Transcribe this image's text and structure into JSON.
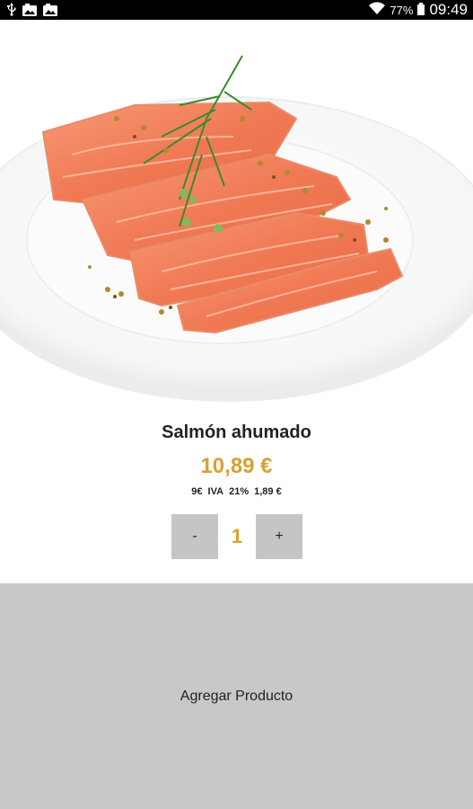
{
  "status_bar": {
    "icons_left": [
      "usb-icon",
      "photo-icon",
      "photo-icon"
    ],
    "battery": "77%",
    "time": "09:49"
  },
  "product": {
    "image_description_icon": "smoked-salmon-plate-image",
    "name": "Salmón ahumado",
    "price": "10,89 €",
    "tax": {
      "base": "9€",
      "label": "IVA",
      "rate": "21%",
      "amount": "1,89 €"
    }
  },
  "quantity": {
    "minus_label": "-",
    "value": "1",
    "plus_label": "+"
  },
  "actions": {
    "add_label": "Agregar Producto"
  },
  "colors": {
    "accent": "#d9a033",
    "button_bg": "#c5c5c5",
    "add_bg": "#c8c8c8",
    "status_bg": "#000000"
  }
}
